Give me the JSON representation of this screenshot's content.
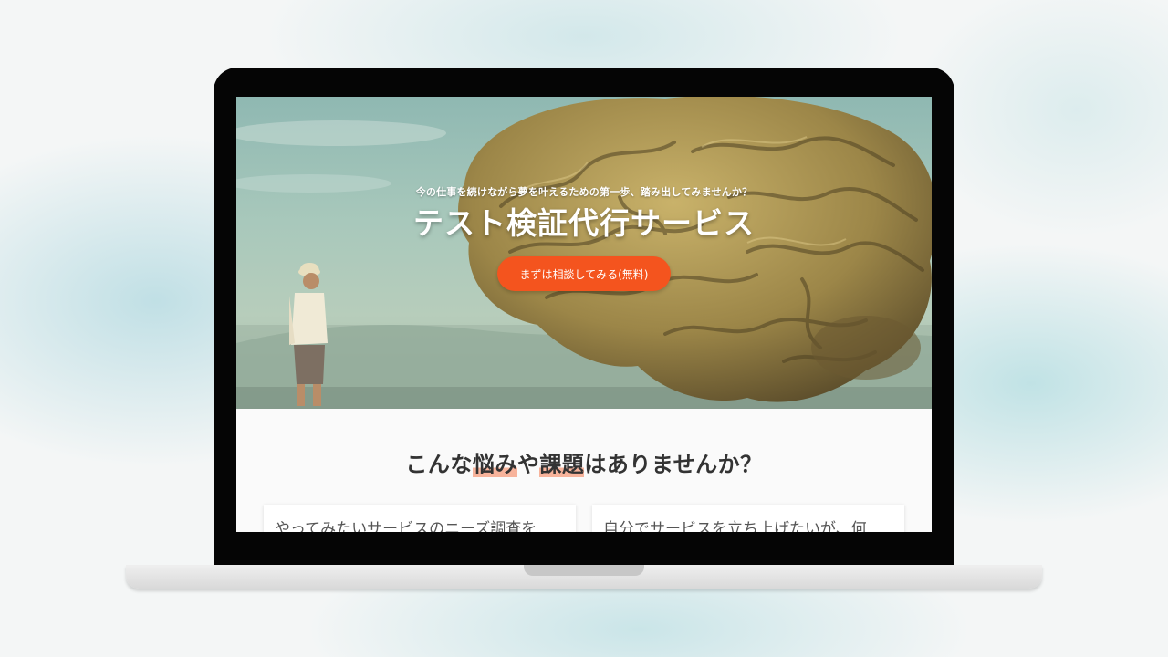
{
  "hero": {
    "tagline": "今の仕事を続けながら夢を叶えるための第一歩、踏み出してみませんか？",
    "title": "テスト検証代行サービス",
    "cta_label": "まずは相談してみる(無料)"
  },
  "section": {
    "title_parts": [
      "こんな",
      "悩み",
      "や",
      "課題",
      "はありませんか？"
    ]
  },
  "cards": [
    {
      "text": "やってみたいサービスのニーズ調査を"
    },
    {
      "text": "自分でサービスを立ち上げたいが、何"
    }
  ],
  "colors": {
    "accent": "#f4541e",
    "highlight": "#f7b39b",
    "laptop_bezel": "#050505"
  }
}
